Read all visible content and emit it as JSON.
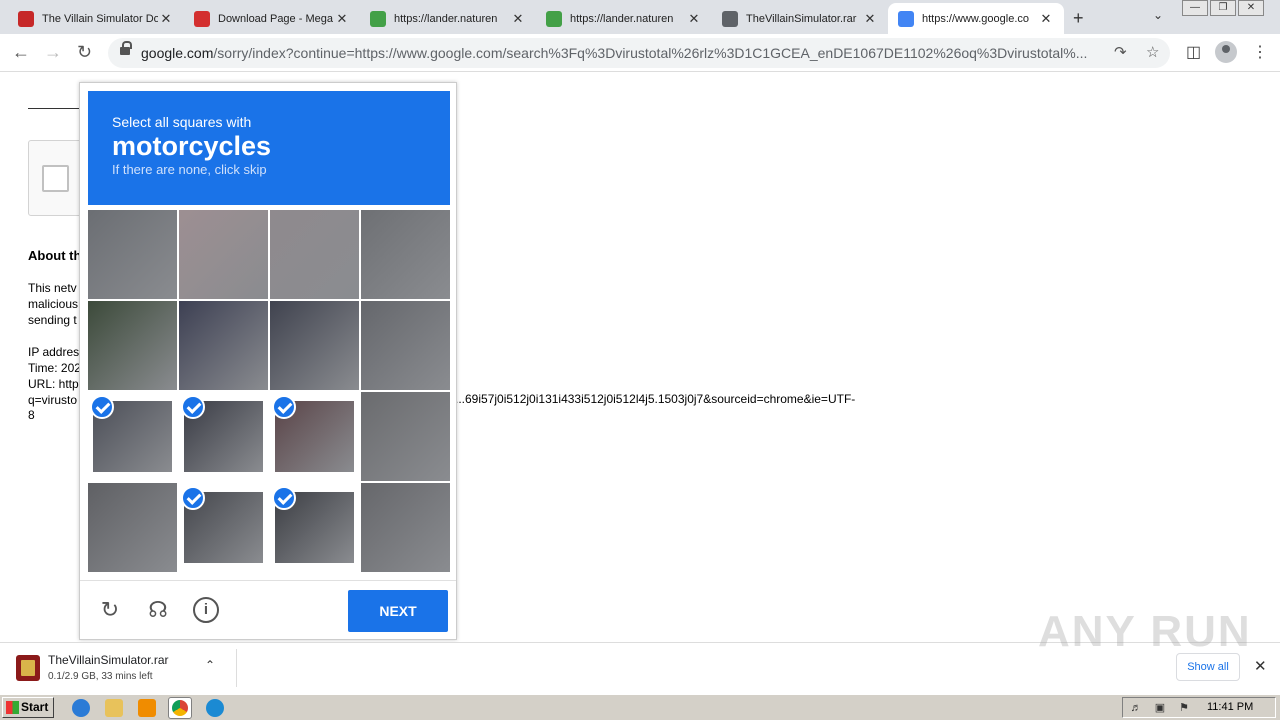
{
  "browser": {
    "tabs": [
      {
        "title": "The Villain Simulator Do",
        "color": "#c62828"
      },
      {
        "title": "Download Page - Mega",
        "color": "#d32f2f"
      },
      {
        "title": "https://lander.naturen",
        "color": "#43a047"
      },
      {
        "title": "https://lander.naturen",
        "color": "#43a047"
      },
      {
        "title": "TheVillainSimulator.rar",
        "color": "#5f6368"
      },
      {
        "title": "https://www.google.co",
        "color": "#4285f4"
      }
    ],
    "url_host": "google.com",
    "url_rest": "/sorry/index?continue=https://www.google.com/search%3Fq%3Dvirustotal%26rlz%3D1C1GCEA_enDE1067DE1102%26oq%3Dvirustotal%..."
  },
  "page": {
    "about_heading": "About th",
    "about_lines": [
      "This netv",
      "malicious",
      "sending t"
    ],
    "info_lines": [
      "IP addres",
      "Time: 202",
      "URL: http",
      "q=virusto"
    ],
    "url_tail": "...69i57j0i512j0i131i433i512j0i512l4j5.1503j0j7&sourceid=chrome&ie=UTF-",
    "url_tail2": "8"
  },
  "captcha": {
    "instruction": "Select all squares with",
    "target": "motorcycles",
    "hint": "If there are none, click skip",
    "next_label": "NEXT",
    "tiles": [
      {
        "selected": false,
        "color": "#6b6e73"
      },
      {
        "selected": false,
        "color": "#9d8f92"
      },
      {
        "selected": false,
        "color": "#8f8a8e"
      },
      {
        "selected": false,
        "color": "#6e7074"
      },
      {
        "selected": false,
        "color": "#3c4a3a"
      },
      {
        "selected": false,
        "color": "#3d4053"
      },
      {
        "selected": false,
        "color": "#40434f"
      },
      {
        "selected": false,
        "color": "#65676c"
      },
      {
        "selected": true,
        "color": "#4c4f58"
      },
      {
        "selected": true,
        "color": "#3a3c45"
      },
      {
        "selected": true,
        "color": "#5a4448"
      },
      {
        "selected": false,
        "color": "#6a6b6e"
      },
      {
        "selected": false,
        "color": "#5f6064"
      },
      {
        "selected": true,
        "color": "#45474d"
      },
      {
        "selected": true,
        "color": "#3c3e44"
      },
      {
        "selected": false,
        "color": "#66676b"
      }
    ]
  },
  "download": {
    "filename": "TheVillainSimulator.rar",
    "status": "0.1/2.9 GB, 33 mins left",
    "show_all": "Show all"
  },
  "watermark": "ANY RUN",
  "taskbar": {
    "start_label": "Start",
    "clock": "11:41 PM"
  }
}
